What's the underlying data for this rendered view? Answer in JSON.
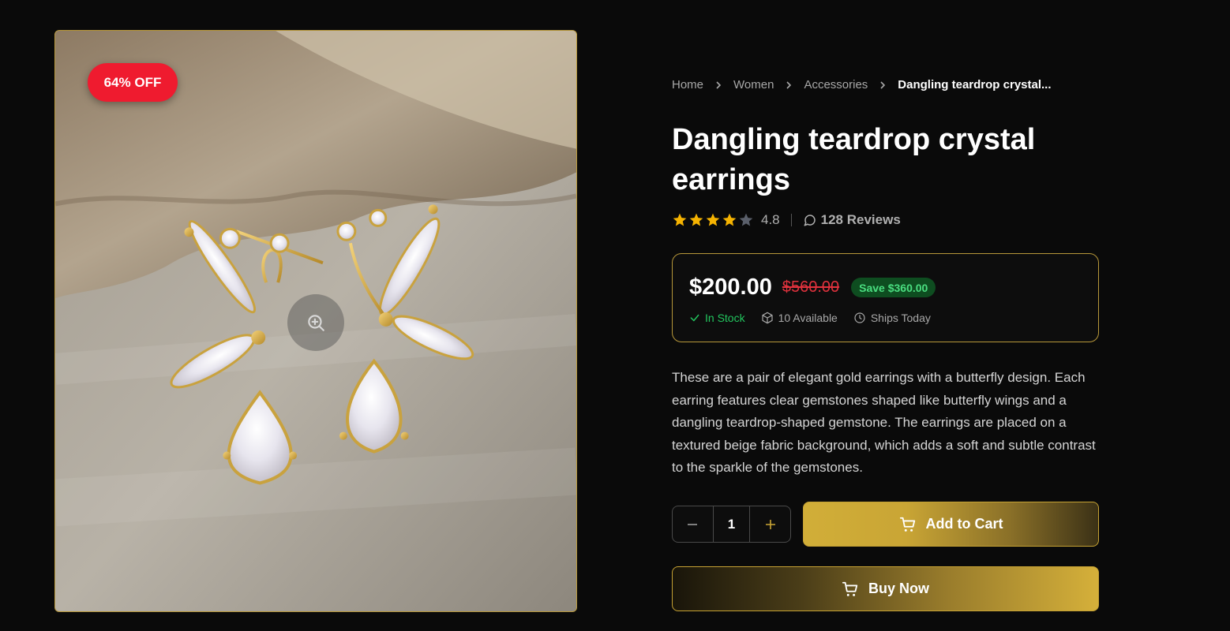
{
  "product_image": {
    "discount_badge": "64% OFF",
    "alt": "Dangling teardrop crystal earrings"
  },
  "breadcrumb": {
    "items": [
      "Home",
      "Women",
      "Accessories"
    ],
    "current": "Dangling teardrop crystal..."
  },
  "product": {
    "title": "Dangling teardrop crystal earrings",
    "rating": "4.8",
    "rating_stars": 4,
    "rating_max": 5,
    "reviews": "128 Reviews"
  },
  "pricing": {
    "current": "$200.00",
    "original": "$560.00",
    "save": "Save $360.00",
    "stock": "In Stock",
    "available": "10 Available",
    "shipping": "Ships Today"
  },
  "description": "These are a pair of elegant gold earrings with a butterfly design. Each earring features clear gemstones shaped like butterfly wings and a dangling teardrop-shaped gemstone. The earrings are placed on a textured beige fabric background, which adds a soft and subtle contrast to the sparkle of the gemstones.",
  "actions": {
    "quantity": "1",
    "add_to_cart": "Add to Cart",
    "buy_now": "Buy Now"
  },
  "colors": {
    "accent_gold": "#c9a535",
    "discount_red": "#ef1b2f",
    "strike_red": "#e0323d",
    "stock_green": "#22c55e",
    "star_gold": "#f5b301",
    "background": "#0a0a0a"
  }
}
